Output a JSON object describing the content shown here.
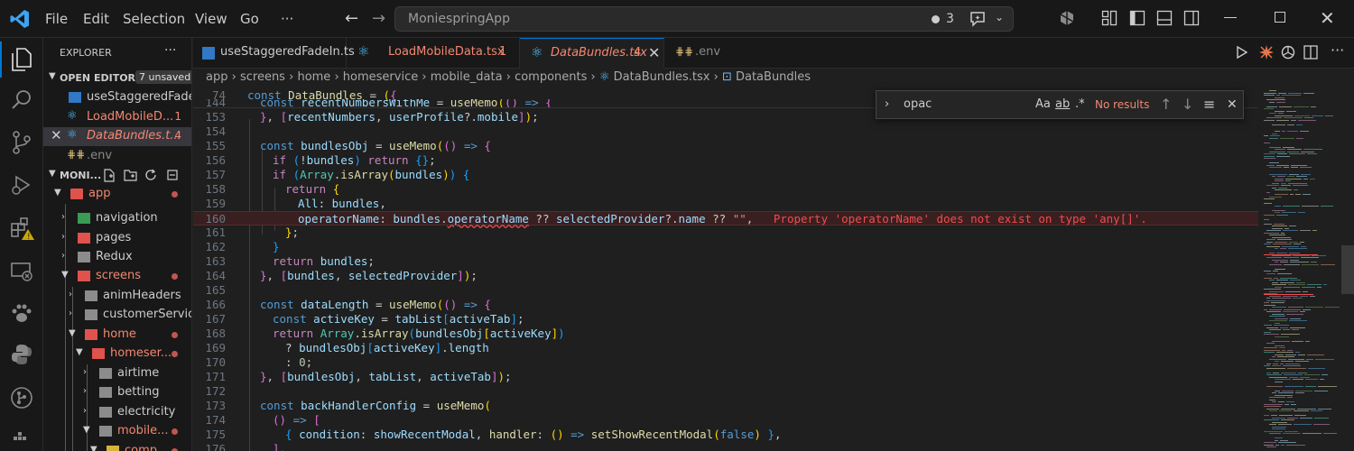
{
  "menu": {
    "file": "File",
    "edit": "Edit",
    "selection": "Selection",
    "view": "View",
    "go": "Go",
    "more": "···"
  },
  "command_center": {
    "text": "MoniespringApp",
    "count": "3"
  },
  "explorer": {
    "title": "EXPLORER",
    "more": "···",
    "open_editors_label": "OPEN EDITORS",
    "unsaved": "7 unsaved",
    "open_editors": [
      {
        "label": "useStaggeredFadeI...",
        "badge": ""
      },
      {
        "label": "LoadMobileD...",
        "badge": "1"
      },
      {
        "label": "DataBundles.t...",
        "badge": "4"
      },
      {
        "label": ".env",
        "badge": ""
      }
    ],
    "project_label": "MONI...",
    "tree": [
      {
        "label": "app"
      },
      {
        "label": "navigation"
      },
      {
        "label": "pages"
      },
      {
        "label": "Redux"
      },
      {
        "label": "screens"
      },
      {
        "label": "animHeaders"
      },
      {
        "label": "customerService"
      },
      {
        "label": "home"
      },
      {
        "label": "homeser..."
      },
      {
        "label": "airtime"
      },
      {
        "label": "betting"
      },
      {
        "label": "electricity"
      },
      {
        "label": "mobile..."
      },
      {
        "label": "comp..."
      }
    ]
  },
  "tabs": [
    {
      "label": "useStaggeredFadeIn.ts",
      "badge": ""
    },
    {
      "label": "LoadMobileData.tsx",
      "badge": "1"
    },
    {
      "label": "DataBundles.tsx",
      "badge": "4"
    },
    {
      "label": ".env",
      "badge": ""
    }
  ],
  "breadcrumb": [
    "app",
    "screens",
    "home",
    "homeservice",
    "mobile_data",
    "components",
    "DataBundles.tsx",
    "DataBundles"
  ],
  "find": {
    "query": "opac",
    "results": "No results",
    "match_case": "Aa",
    "whole_word": "ab"
  },
  "editor": {
    "sticky_74": "74",
    "sticky_144": "144",
    "line_numbers": [
      "153",
      "154",
      "155",
      "156",
      "157",
      "158",
      "159",
      "160",
      "161",
      "162",
      "163",
      "164",
      "165",
      "166",
      "167",
      "168",
      "169",
      "170",
      "171",
      "172",
      "173",
      "174",
      "175",
      "176"
    ],
    "error_message": "Property 'operatorName' does not exist on type 'any[]'."
  },
  "colors": {
    "accent": "#0078d4",
    "error": "#f14c4c",
    "modified": "#f48771"
  }
}
